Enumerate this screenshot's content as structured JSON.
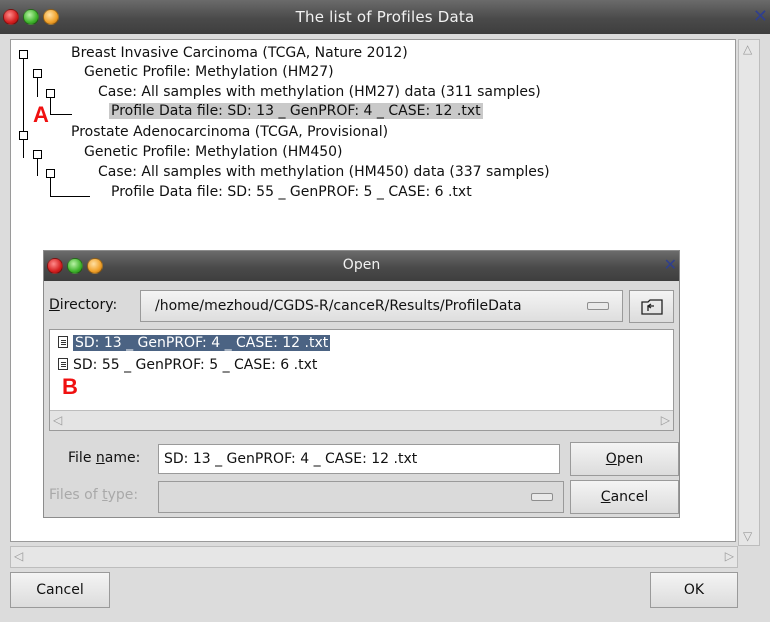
{
  "window": {
    "title": "The list of Profiles Data"
  },
  "tree": {
    "nodes": [
      {
        "label": "Breast Invasive Carcinoma (TCGA, Nature 2012)"
      },
      {
        "label": "Genetic Profile:  Methylation (HM27)"
      },
      {
        "label": "Case:  All samples with methylation (HM27) data (311 samples)"
      },
      {
        "label": "Profile Data file:  SD: 13 _ GenPROF: 4 _ CASE: 12 .txt"
      },
      {
        "label": "Prostate Adenocarcinoma (TCGA, Provisional)"
      },
      {
        "label": "Genetic Profile:  Methylation (HM450)"
      },
      {
        "label": "Case:  All samples with methylation (HM450) data (337 samples)"
      },
      {
        "label": "Profile Data file:  SD: 55 _ GenPROF: 5 _ CASE: 6 .txt"
      }
    ]
  },
  "markers": {
    "a": "A",
    "b": "B"
  },
  "dialog": {
    "title": "Open",
    "directory_label_prefix": "D",
    "directory_label_rest": "irectory:",
    "directory_value": "/home/mezhoud/CGDS-R/canceR/Results/ProfileData",
    "files": [
      {
        "name": "SD: 13 _ GenPROF: 4 _ CASE: 12 .txt"
      },
      {
        "name": "SD: 55 _ GenPROF: 5 _ CASE: 6 .txt"
      }
    ],
    "filename_label_pre": "File ",
    "filename_label_u": "n",
    "filename_label_post": "ame:",
    "filename_value": "SD: 13 _ GenPROF: 4 _ CASE: 12 .txt",
    "filetype_label_pre": "Files of ",
    "filetype_label_u": "t",
    "filetype_label_post": "ype:",
    "open_u": "O",
    "open_rest": "pen",
    "cancel_u": "C",
    "cancel_rest": "ancel"
  },
  "buttons": {
    "cancel": "Cancel",
    "ok": "OK"
  }
}
